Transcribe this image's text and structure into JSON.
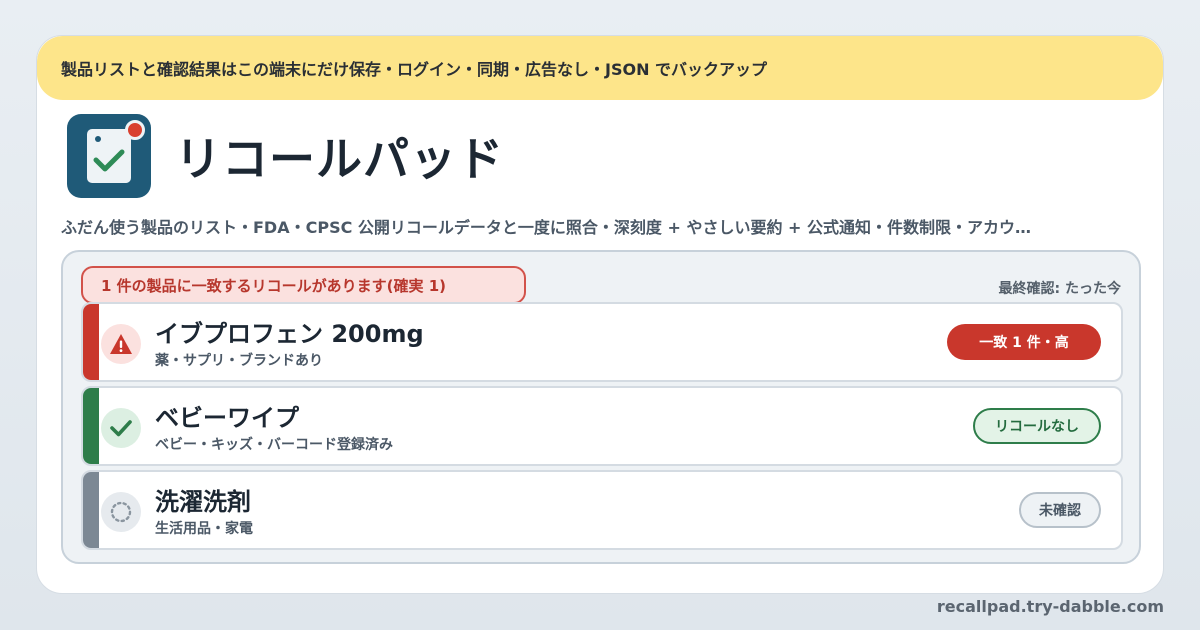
{
  "banner": {
    "text": "製品リストと確認結果はこの端末にだけ保存・ログイン・同期・広告なし・JSON でバックアップ"
  },
  "app": {
    "title": "リコールパッド",
    "subtitle": "ふだん使う製品のリスト・FDA・CPSC 公開リコールデータと一度に照合・深刻度 + やさしい要約 + 公式通知・件数制限・アカウ…",
    "icon": "clipboard-check-icon",
    "accent": "#1f5a78",
    "notification_color": "#d9402f"
  },
  "panel": {
    "match_summary": "1 件の製品に一致するリコールがあります(確実 1)",
    "last_checked": "最終確認: たった今",
    "products": [
      {
        "name": "イブプロフェン 200mg",
        "category": "薬・サプリ・ブランドあり",
        "status": "一致 1 件・高",
        "status_kind": "recall",
        "icon": "warning-icon",
        "stripe_color": "#c9372c"
      },
      {
        "name": "ベビーワイプ",
        "category": "ベビー・キッズ・バーコード登録済み",
        "status": "リコールなし",
        "status_kind": "clear",
        "icon": "check-icon",
        "stripe_color": "#2e7d4a"
      },
      {
        "name": "洗濯洗剤",
        "category": "生活用品・家電",
        "status": "未確認",
        "status_kind": "unchecked",
        "icon": "pending-icon",
        "stripe_color": "#7c8894"
      }
    ]
  },
  "footer": {
    "url": "recallpad.try-dabble.com"
  }
}
